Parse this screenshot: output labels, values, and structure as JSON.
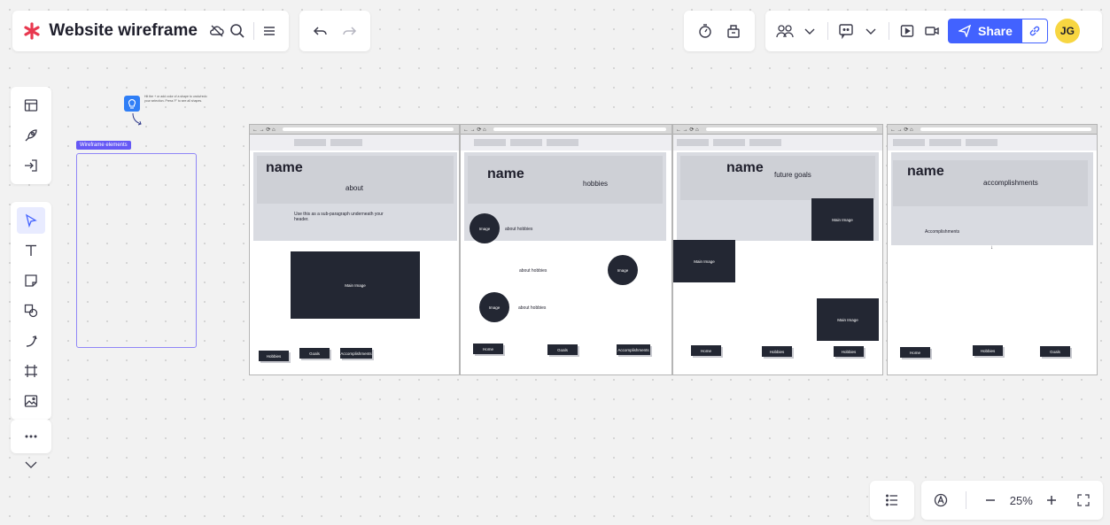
{
  "header": {
    "board_title": "Website wireframe",
    "share_label": "Share",
    "avatar_initials": "JG"
  },
  "zoom": {
    "level": "25%"
  },
  "tip_text": "Hit the + or add color of a shape to undo/redo your selection. Press 'F' to see all shapes.",
  "frame": {
    "label": "Wireframe elements"
  },
  "wireframes": {
    "w1": {
      "name": "name",
      "section": "about",
      "paragraph": "Use this as a sub-paragraph underneath your header.",
      "main_image": "Main Image",
      "buttons": [
        "Hobbies",
        "Goals",
        "Accomplishments"
      ]
    },
    "w2": {
      "name": "name",
      "section": "hobbies",
      "image": "Image",
      "about1": "about hobbies",
      "about2": "about hobbies",
      "about3": "about hobbies",
      "buttons": [
        "Home",
        "Goals",
        "Accomplishments"
      ]
    },
    "w3": {
      "name": "name",
      "section": "future goals",
      "main_image": "Main Image",
      "buttons": [
        "Home",
        "Hobbies",
        "Hobbies"
      ]
    },
    "w4": {
      "name": "name",
      "section": "accomplishments",
      "text": "Accomplishments",
      "buttons": [
        "Home",
        "Hobbies",
        "Goals"
      ]
    }
  },
  "colors": {
    "accent": "#4262ff",
    "logo": "#e8384f",
    "avatar": "#f7d641",
    "dark_block": "#232733"
  }
}
